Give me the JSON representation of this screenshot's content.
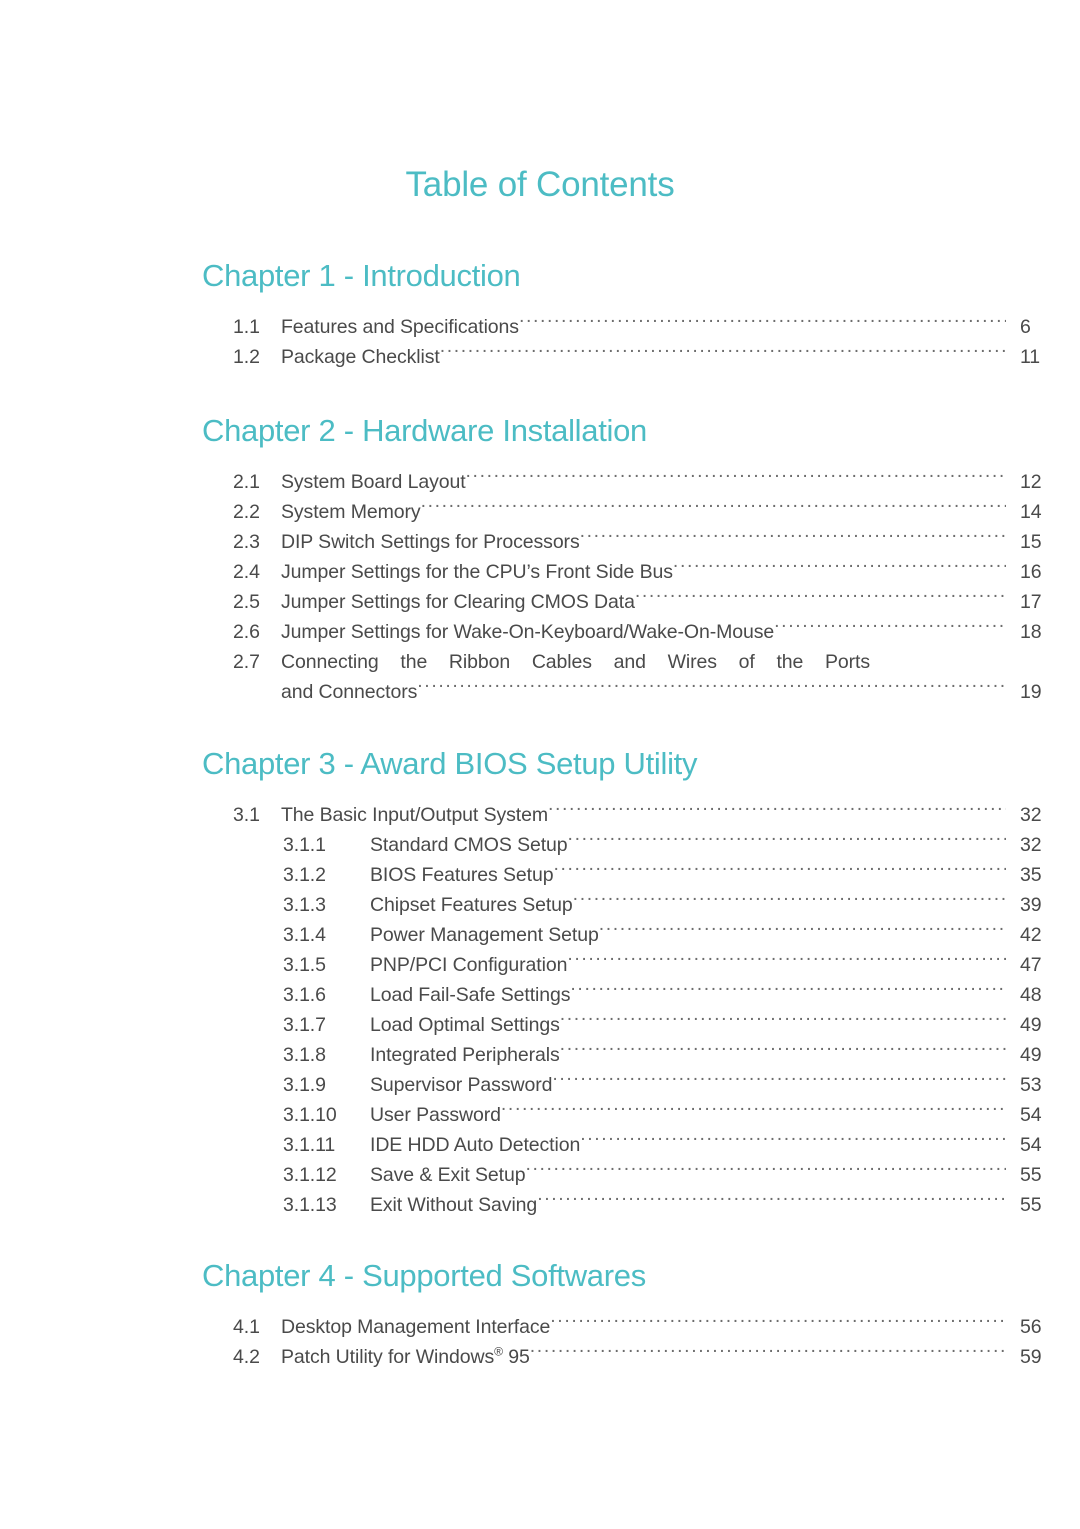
{
  "document": {
    "title": "Table of Contents",
    "accent_color": "#4cbcc4",
    "text_color": "#4a4a4a",
    "background_color": "#ffffff"
  },
  "chapters": [
    {
      "heading": "Chapter 1 - Introduction",
      "entries": [
        {
          "number": "1.1",
          "label": "Features and Specifications",
          "page": "6",
          "level": 1
        },
        {
          "number": "1.2",
          "label": "Package Checklist",
          "page": "11",
          "level": 1
        }
      ]
    },
    {
      "heading": "Chapter 2 - Hardware Installation",
      "entries": [
        {
          "number": "2.1",
          "label": "System Board Layout",
          "page": "12",
          "level": 1
        },
        {
          "number": "2.2",
          "label": "System Memory",
          "page": "14",
          "level": 1
        },
        {
          "number": "2.3",
          "label": "DIP Switch Settings for Processors",
          "page": "15",
          "level": 1
        },
        {
          "number": "2.4",
          "label": "Jumper Settings for the CPU’s Front Side Bus",
          "page": "16",
          "level": 1
        },
        {
          "number": "2.5",
          "label": "Jumper Settings for Clearing CMOS Data",
          "page": "17",
          "level": 1
        },
        {
          "number": "2.6",
          "label": "Jumper Settings for Wake-On-Keyboard/Wake-On-Mouse",
          "page": "18",
          "level": 1
        },
        {
          "number": "2.7",
          "label": "Connecting the Ribbon Cables and Wires of the Ports",
          "label_continued": "and Connectors",
          "page": "19",
          "level": 1,
          "wraps": true
        }
      ]
    },
    {
      "heading": "Chapter 3 - Award BIOS Setup Utility",
      "entries": [
        {
          "number": "3.1",
          "label": "The Basic Input/Output System",
          "page": "32",
          "level": 1
        },
        {
          "number": "3.1.1",
          "label": "Standard CMOS Setup",
          "page": "32",
          "level": 2
        },
        {
          "number": "3.1.2",
          "label": "BIOS Features Setup",
          "page": "35",
          "level": 2
        },
        {
          "number": "3.1.3",
          "label": "Chipset Features Setup",
          "page": "39",
          "level": 2
        },
        {
          "number": "3.1.4",
          "label": "Power Management Setup",
          "page": "42",
          "level": 2
        },
        {
          "number": "3.1.5",
          "label": "PNP/PCI Configuration",
          "page": "47",
          "level": 2
        },
        {
          "number": "3.1.6",
          "label": "Load Fail-Safe Settings",
          "page": "48",
          "level": 2
        },
        {
          "number": "3.1.7",
          "label": "Load Optimal Settings",
          "page": "49",
          "level": 2
        },
        {
          "number": "3.1.8",
          "label": "Integrated Peripherals",
          "page": "49",
          "level": 2
        },
        {
          "number": "3.1.9",
          "label": "Supervisor Password",
          "page": "53",
          "level": 2
        },
        {
          "number": "3.1.10",
          "label": "User Password",
          "page": "54",
          "level": 2
        },
        {
          "number": "3.1.11",
          "label": "IDE HDD Auto Detection",
          "page": "54",
          "level": 2
        },
        {
          "number": "3.1.12",
          "label": "Save & Exit Setup",
          "page": "55",
          "level": 2
        },
        {
          "number": "3.1.13",
          "label": "Exit Without Saving",
          "page": "55",
          "level": 2
        }
      ]
    },
    {
      "heading": "Chapter 4 - Supported Softwares",
      "entries": [
        {
          "number": "4.1",
          "label": "Desktop Management Interface",
          "page": "56",
          "level": 1
        },
        {
          "number": "4.2",
          "label": "Patch Utility for Windows",
          "label_suffix_sup": "®",
          "label_suffix": " 95",
          "page": "59",
          "level": 1
        }
      ]
    }
  ]
}
